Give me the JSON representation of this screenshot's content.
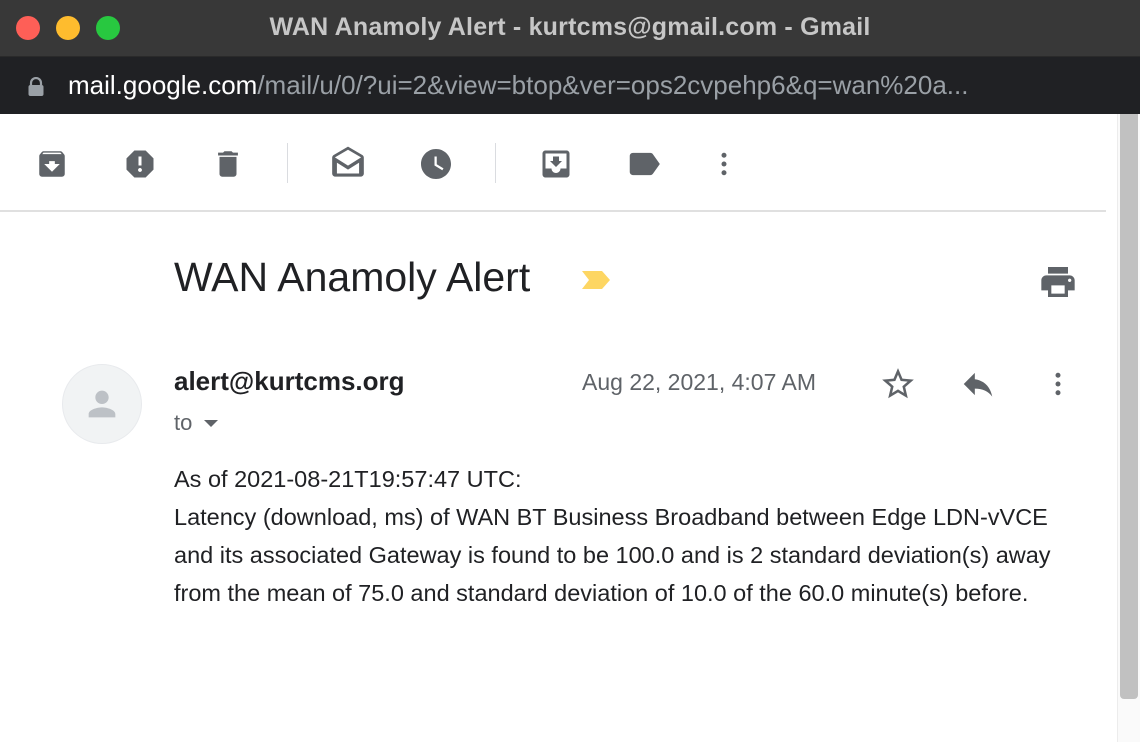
{
  "window": {
    "title": "WAN Anamoly Alert - kurtcms@gmail.com - Gmail"
  },
  "address_bar": {
    "host": "mail.google.com",
    "path": "/mail/u/0/?ui=2&view=btop&ver=ops2cvpehp6&q=wan%20a..."
  },
  "toolbar": {
    "buttons": [
      "archive-icon",
      "report-spam-icon",
      "delete-icon",
      "mark-unread-icon",
      "snooze-icon",
      "move-to-icon",
      "labels-icon",
      "more-vert-icon"
    ]
  },
  "email": {
    "subject": "WAN Anamoly Alert",
    "label_color": "#fdd663",
    "sender": "alert@kurtcms.org",
    "recipients_label": "to",
    "date": "Aug 22, 2021, 4:07 AM",
    "body_line1": "As of 2021-08-21T19:57:47 UTC:",
    "body_line2": "Latency (download, ms) of WAN BT Business Broadband between Edge LDN-vVCE and its associated Gateway is found to be 100.0 and is 2 standard deviation(s) away from the mean of 75.0 and standard deviation of 10.0 of the 60.0 minute(s) before."
  },
  "colors": {
    "titlebar": "#383838",
    "urlbar": "#202124",
    "icon": "#5f6368",
    "text": "#202124"
  }
}
